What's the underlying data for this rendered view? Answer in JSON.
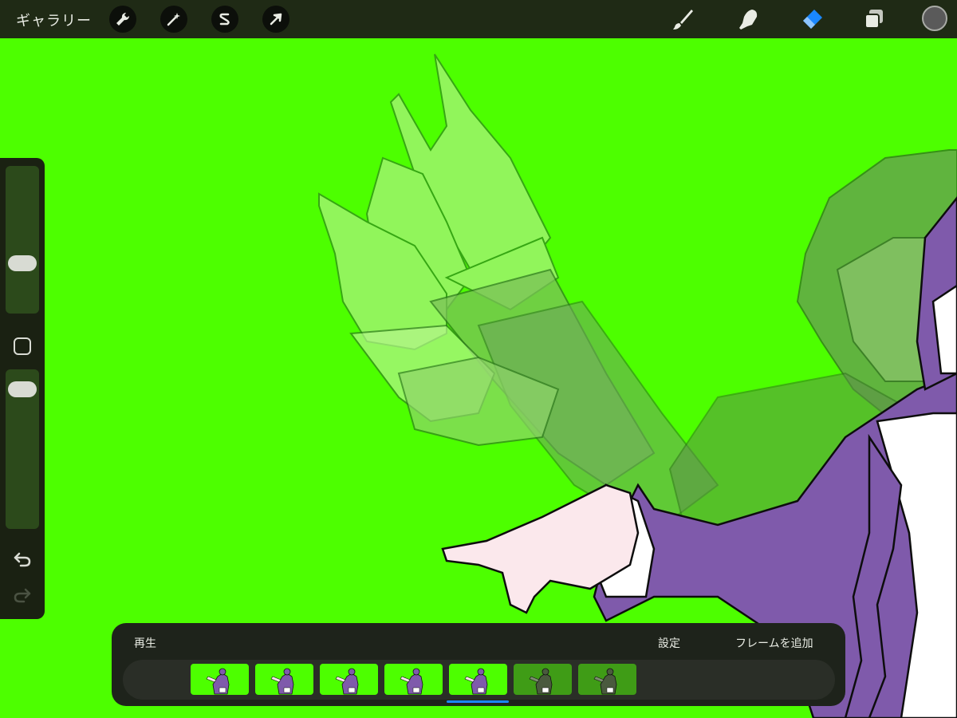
{
  "topbar": {
    "gallery_label": "ギャラリー",
    "left_tools": [
      {
        "name": "actions",
        "icon": "wrench-icon"
      },
      {
        "name": "adjustments",
        "icon": "magic-wand-icon"
      },
      {
        "name": "selection",
        "icon": "selection-s-icon"
      },
      {
        "name": "transform",
        "icon": "arrow-cursor-icon"
      }
    ],
    "right_tools": [
      {
        "name": "brush",
        "icon": "brush-icon",
        "active": false
      },
      {
        "name": "smudge",
        "icon": "smudge-finger-icon",
        "active": false
      },
      {
        "name": "eraser",
        "icon": "eraser-icon",
        "active": true
      },
      {
        "name": "layers",
        "icon": "layers-icon",
        "active": false
      }
    ],
    "current_color": "#5a5a5a"
  },
  "sidebar": {
    "brush_size_icon": "slider-thumb",
    "modify_icon": "square-modify-icon",
    "opacity_icon": "slider-thumb",
    "undo_icon": "undo-arrow-icon",
    "redo_icon": "redo-arrow-icon"
  },
  "timeline": {
    "play_label": "再生",
    "settings_label": "設定",
    "add_frame_label": "フレームを追加",
    "frames": [
      {
        "state": "normal"
      },
      {
        "state": "normal"
      },
      {
        "state": "normal"
      },
      {
        "state": "normal"
      },
      {
        "state": "selected"
      },
      {
        "state": "hidden"
      },
      {
        "state": "hidden"
      }
    ],
    "active_frame": 5
  },
  "colors": {
    "canvas_bg": "#4dff00",
    "toolbar_bg": "#1f2a15",
    "accent_blue": "#1a87ff",
    "jacket_purple": "#7f5aab"
  }
}
